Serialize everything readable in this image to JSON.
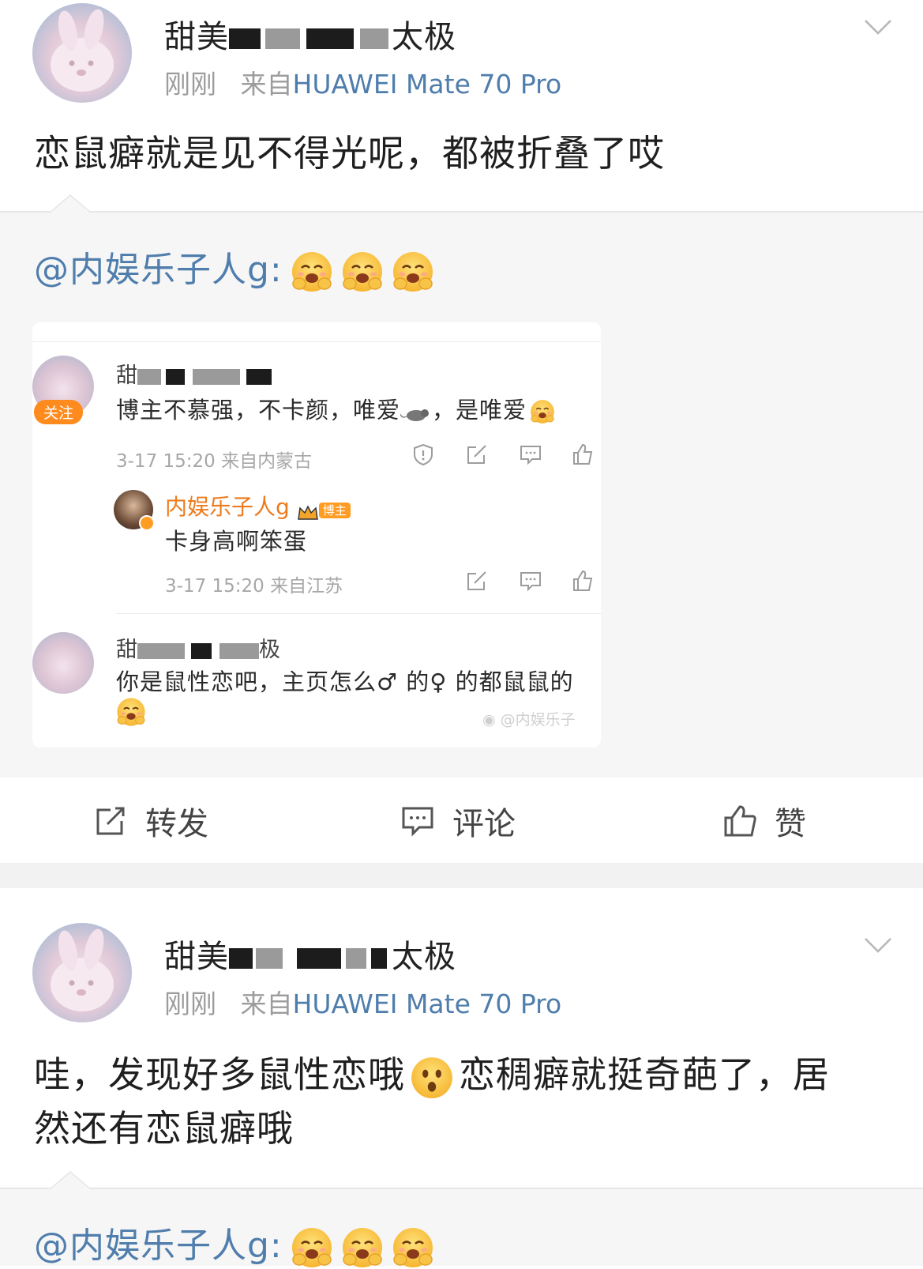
{
  "post1": {
    "username_visible": "甜美",
    "username_tail": "太极",
    "time": "刚刚",
    "source_prefix": "来自",
    "device": "HUAWEI Mate 70 Pro",
    "text": "恋鼠癖就是见不得光呢，都被折叠了哎",
    "retweet": {
      "mention": "@内娱乐子人g:",
      "emojis": [
        "hugging-face",
        "hugging-face",
        "hugging-face"
      ]
    },
    "embedded_screenshot": {
      "comment1": {
        "name_prefix": "甜",
        "follow_label": "关注",
        "text": "博主不慕强，不卡颜，唯爱",
        "text_tail": "，是唯爱",
        "meta": "3-17 15:20 来自内蒙古"
      },
      "reply": {
        "name": "内娱乐子人g",
        "badge": "博主",
        "text": "卡身高啊笨蛋",
        "meta": "3-17 15:20 来自江苏"
      },
      "comment2": {
        "name_prefix": "甜",
        "name_tail": "极",
        "text": "你是鼠性恋吧，主页怎么♂ 的♀ 的都鼠鼠的",
        "watermark": "@内娱乐子"
      }
    },
    "actions": {
      "repost": "转发",
      "comment": "评论",
      "like": "赞"
    }
  },
  "post2": {
    "username_visible": "甜美",
    "username_tail": "太极",
    "time": "刚刚",
    "source_prefix": "来自",
    "device": "HUAWEI Mate 70 Pro",
    "text_line1": "哇，发现好多鼠性恋哦",
    "text_line1_tail": "恋稠癖就挺奇葩了，居",
    "text_line2": "然还有恋鼠癖哦",
    "retweet": {
      "mention": "@内娱乐子人g:",
      "emojis": [
        "hugging-face",
        "hugging-face",
        "hugging-face"
      ]
    }
  },
  "colors": {
    "link_blue": "#4f7dac",
    "meta_gray": "#9c9c9c",
    "panel_gray": "#f6f6f6",
    "accent_orange": "#ff8b1f"
  }
}
